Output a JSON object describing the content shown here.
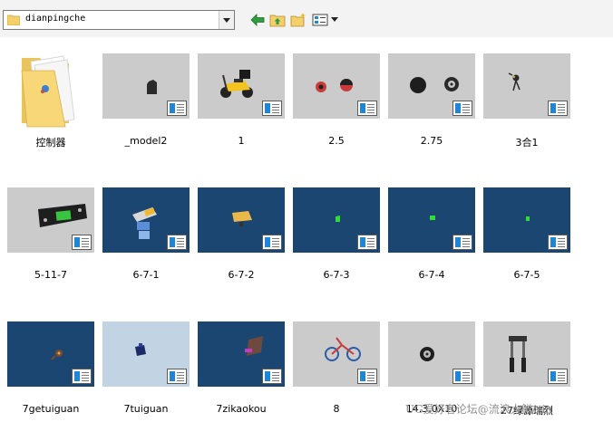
{
  "address_bar": {
    "path": "dianpingche"
  },
  "toolbar": {
    "back_icon": "back-arrow-icon",
    "up_icon": "up-folder-icon",
    "new_folder_icon": "new-folder-icon",
    "view_icon": "view-menu-icon"
  },
  "items": [
    {
      "name": "控制器",
      "kind": "folder"
    },
    {
      "name": "_model2",
      "kind": "part"
    },
    {
      "name": "1",
      "kind": "part"
    },
    {
      "name": "2.5",
      "kind": "part"
    },
    {
      "name": "2.75",
      "kind": "part"
    },
    {
      "name": "3合1",
      "kind": "part"
    },
    {
      "name": "5-11-7",
      "kind": "part"
    },
    {
      "name": "6-7-1",
      "kind": "part"
    },
    {
      "name": "6-7-2",
      "kind": "part"
    },
    {
      "name": "6-7-3",
      "kind": "part"
    },
    {
      "name": "6-7-4",
      "kind": "part"
    },
    {
      "name": "6-7-5",
      "kind": "part"
    },
    {
      "name": "7getuiguan",
      "kind": "part"
    },
    {
      "name": "7tuiguan",
      "kind": "part"
    },
    {
      "name": "7zikaokou",
      "kind": "part"
    },
    {
      "name": "8",
      "kind": "part"
    },
    {
      "name": "14.3.0X10",
      "kind": "part"
    },
    {
      "name": "27绿源瑞烈",
      "kind": "part"
    }
  ],
  "watermark": "UG爱好者论坛@流浪大鲜/xin",
  "colors": {
    "thumb_gray": "#cbcbcb",
    "thumb_blue": "#1a4671",
    "thumb_light": "#c2d4e3",
    "badge_blue": "#1d86d8"
  }
}
